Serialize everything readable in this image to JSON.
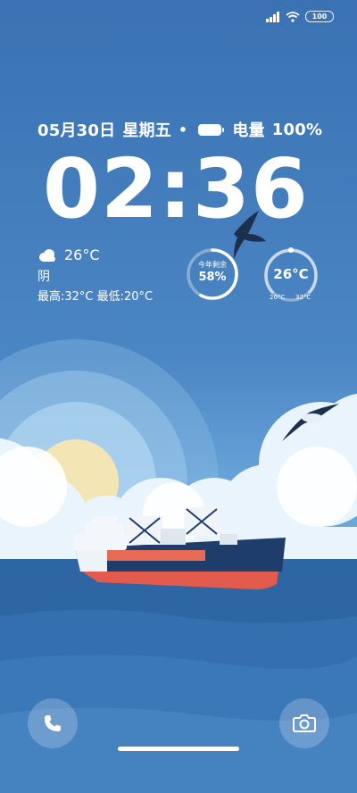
{
  "status_bar": {
    "battery_level": "100",
    "icons": [
      "signal-icon",
      "wifi-icon",
      "battery-icon"
    ]
  },
  "lockscreen": {
    "date": "05月30日",
    "weekday": "星期五",
    "separator": "•",
    "battery_label": "电量",
    "battery_percent": "100%",
    "time": "02:36"
  },
  "weather": {
    "temp": "26°C",
    "condition": "阴",
    "high_low": "最高:32°C 最低:20°C",
    "icon": "cloud-icon"
  },
  "year_widget": {
    "label": "今年剩余",
    "value": "58%",
    "progress_fraction": 0.58
  },
  "temp_widget": {
    "value": "26°C",
    "low": "20°C",
    "high": "32°C"
  },
  "dock": {
    "left_icon": "phone-icon",
    "right_icon": "camera-icon"
  },
  "colors": {
    "sky_top": "#3a72b3",
    "sea": "#2f6aa8",
    "ship_hull": "#1f3d6b",
    "ship_stripe": "#e25b4d"
  }
}
